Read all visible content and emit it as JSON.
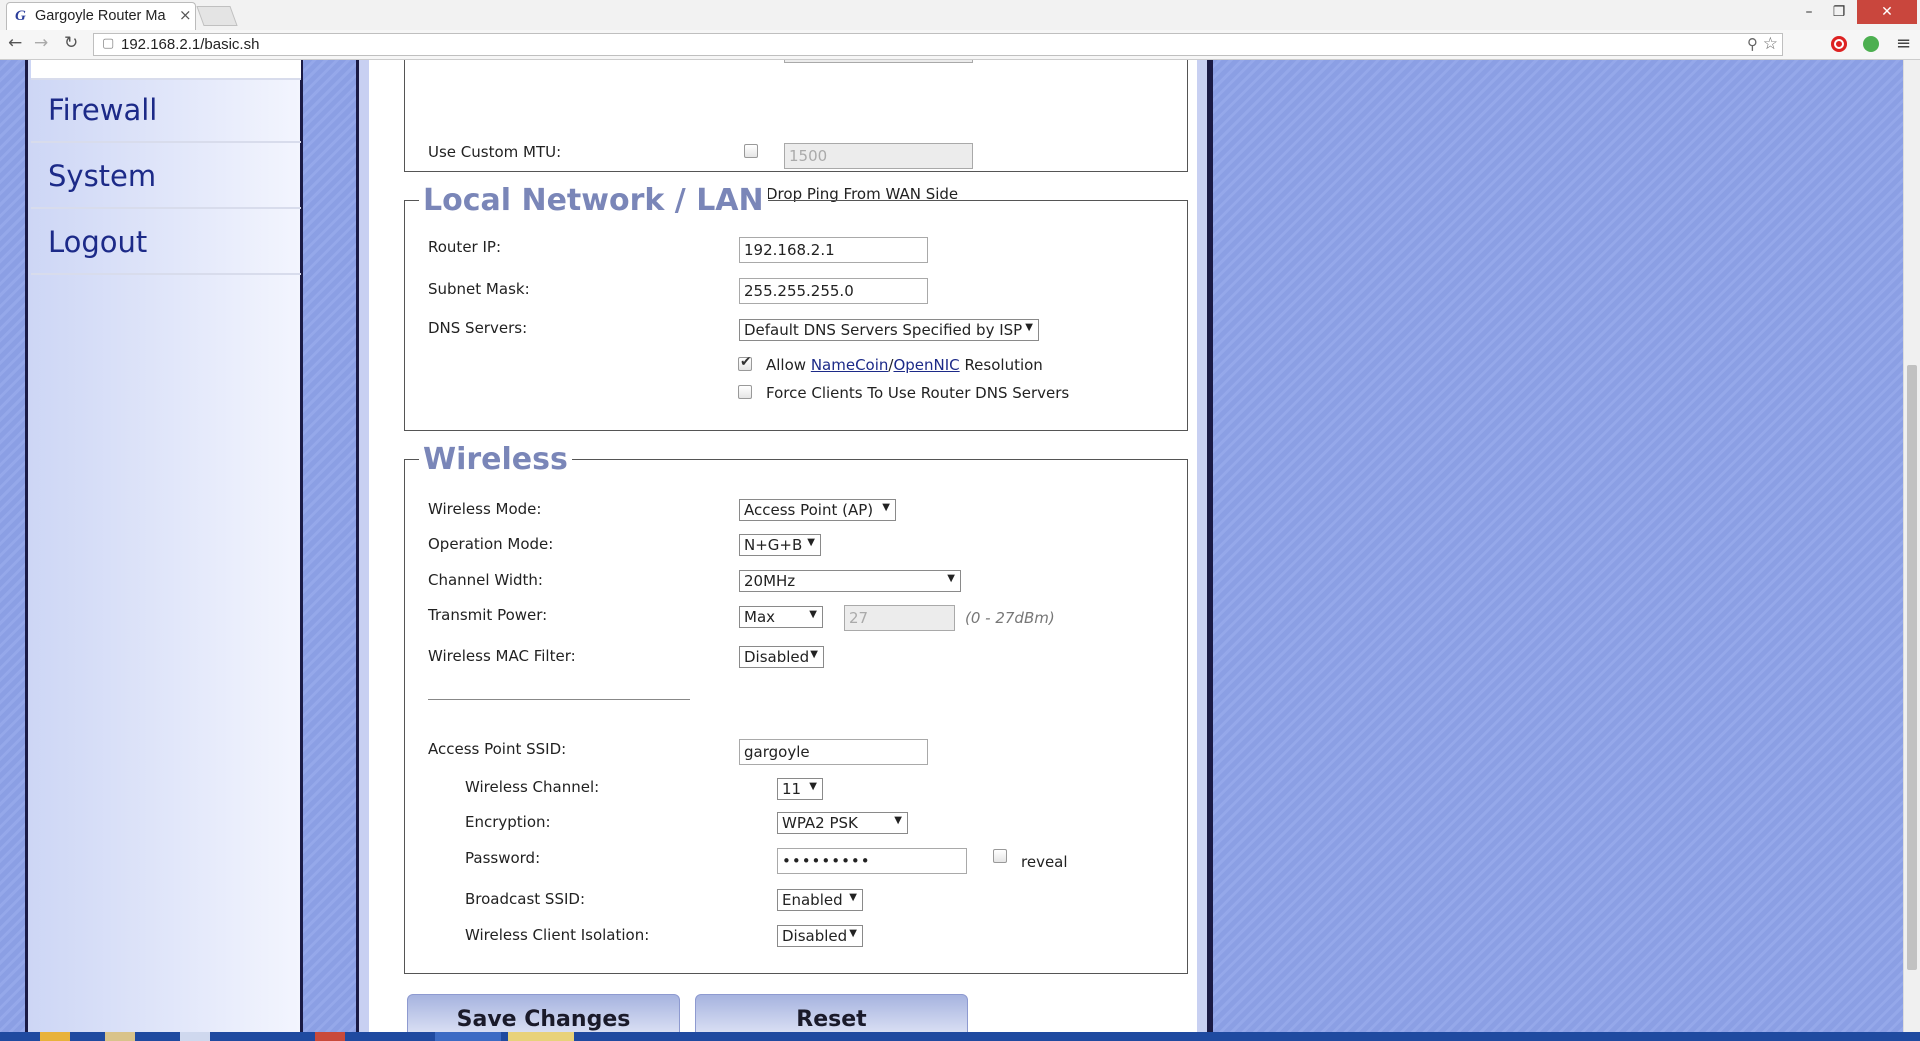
{
  "browser": {
    "tab_title": "Gargoyle Router Ma",
    "tab_close": "×",
    "favicon": "G",
    "url": "192.168.2.1/basic.sh",
    "window_min": "–",
    "window_max": "❐",
    "window_close": "✕",
    "back": "←",
    "forward": "→",
    "reload": "↻",
    "page_icon": "▢",
    "zoom_icon": "⚲",
    "star_icon": "☆",
    "menu_icon": "≡"
  },
  "sidebar": {
    "items": [
      {
        "label": "Firewall"
      },
      {
        "label": "System"
      },
      {
        "label": "Logout"
      }
    ]
  },
  "wan": {
    "custom_mtu_label": "Use Custom MTU:",
    "custom_mtu_value": "1500",
    "drop_ping_label": "Drop Ping From WAN Side"
  },
  "lan": {
    "legend": "Local Network / LAN",
    "router_ip_label": "Router IP:",
    "router_ip": "192.168.2.1",
    "subnet_label": "Subnet Mask:",
    "subnet": "255.255.255.0",
    "dns_label": "DNS Servers:",
    "dns_value": "Default DNS Servers Specified by ISP",
    "allow_prefix": "Allow",
    "namecoin": "NameCoin",
    "slash": "/",
    "opennic": "OpenNIC",
    "allow_suffix": "Resolution",
    "force_label": "Force Clients To Use Router DNS Servers"
  },
  "wireless": {
    "legend": "Wireless",
    "mode_label": "Wireless Mode:",
    "mode_value": "Access Point (AP)",
    "op_label": "Operation Mode:",
    "op_value": "N+G+B",
    "width_label": "Channel Width:",
    "width_value": "20MHz",
    "power_label": "Transmit Power:",
    "power_value": "Max",
    "power_num": "27",
    "power_hint": "(0 - 27dBm)",
    "mac_label": "Wireless MAC Filter:",
    "mac_value": "Disabled",
    "ssid_label": "Access Point SSID:",
    "ssid": "gargoyle",
    "channel_label": "Wireless Channel:",
    "channel_value": "11",
    "enc_label": "Encryption:",
    "enc_value": "WPA2 PSK",
    "pass_label": "Password:",
    "pass_value": "•••••••••",
    "reveal_label": "reveal",
    "broadcast_label": "Broadcast SSID:",
    "broadcast_value": "Enabled",
    "isolation_label": "Wireless Client Isolation:",
    "isolation_value": "Disabled"
  },
  "actions": {
    "save": "Save Changes",
    "reset": "Reset"
  },
  "colors": {
    "accent": "#1c2a88",
    "legend": "#7a86b8",
    "background": "#8fa2e6"
  }
}
